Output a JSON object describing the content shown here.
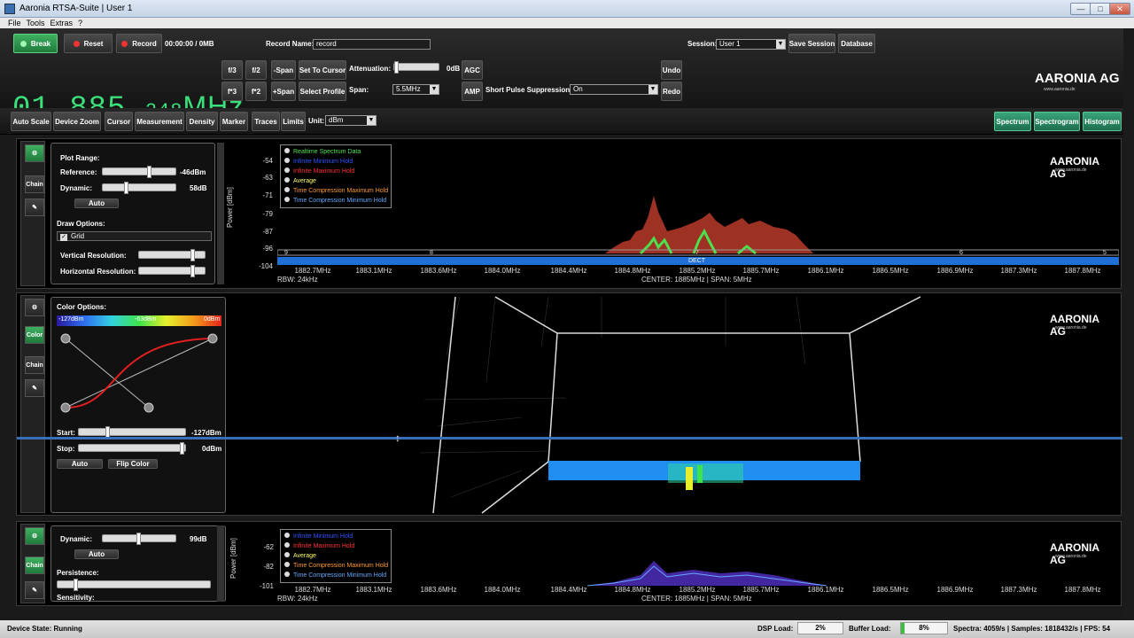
{
  "window": {
    "title": "Aaronia RTSA-Suite | User 1",
    "min": "—",
    "max": "□",
    "close": "✕"
  },
  "menu": [
    "File",
    "Tools",
    "Extras",
    "?"
  ],
  "toolbar": {
    "break_label": "Break",
    "reset_label": "Reset",
    "record_label": "Record",
    "record_time": "00:00:00 / 0MB",
    "record_name_label": "Record Name:",
    "record_name_value": "record",
    "session_label": "Session:",
    "session_value": "User 1",
    "save_session": "Save Session",
    "database": "Database",
    "frequency_main": "01.885.",
    "frequency_small": "248",
    "frequency_unit": "MHz",
    "f3": "f/3",
    "f2": "f/2",
    "minus_span": "-Span",
    "set_to_cursor": "Set To Cursor",
    "f3x": "f*3",
    "f2x": "f*2",
    "plus_span": "+Span",
    "select_profile": "Select Profile",
    "attenuation_label": "Attenuation:",
    "attenuation_value": "0dB",
    "span_label": "Span:",
    "span_value": "5.5MHz",
    "agc": "AGC",
    "amp": "AMP",
    "short_pulse_label": "Short Pulse Suppression:",
    "short_pulse_value": "On",
    "undo": "Undo",
    "redo": "Redo",
    "logo": "AARONIA AG",
    "logo_sub": "www.aaronia.de"
  },
  "toolbar2": {
    "buttons": [
      "Auto Scale",
      "Device Zoom",
      "Cursor",
      "Measurement",
      "Density",
      "Marker",
      "Traces",
      "Limits"
    ],
    "unit_label": "Unit:",
    "unit_value": "dBm",
    "views": [
      "Spectrum",
      "Spectrogram",
      "Histogram"
    ]
  },
  "colors": {
    "accent_green": "#3ce07a",
    "band_blue": "#1f6fd6",
    "trace_red": "#c0392b"
  },
  "spectrum": {
    "side": {
      "chain": "Chain"
    },
    "options": {
      "plot_range": "Plot Range:",
      "reference_label": "Reference:",
      "reference_value": "-46dBm",
      "dynamic_label": "Dynamic:",
      "dynamic_value": "58dB",
      "auto": "Auto",
      "draw_options": "Draw Options:",
      "grid": "Grid",
      "vres_label": "Vertical Resolution:",
      "hres_label": "Horizontal Resolution:"
    },
    "yaxis_label": "Power [dBm]",
    "yticks": [
      "-54",
      "-63",
      "-71",
      "-79",
      "-87",
      "-96",
      "-104"
    ],
    "xticks": [
      "1882.7MHz",
      "1883.1MHz",
      "1883.6MHz",
      "1884.0MHz",
      "1884.4MHz",
      "1884.8MHz",
      "1885.2MHz",
      "1885.7MHz",
      "1886.1MHz",
      "1886.5MHz",
      "1886.9MHz",
      "1887.3MHz",
      "1887.8MHz"
    ],
    "rbw": "RBW: 24kHz",
    "center": "CENTER: 1885MHz | SPAN: 5MHz",
    "channels": [
      "9",
      "8",
      "7",
      "6",
      "5"
    ],
    "band_label": "DECT",
    "legend": [
      {
        "label": "Realtime Spectrum Data",
        "color": "#4de04d"
      },
      {
        "label": "Infinite Minimum Hold",
        "color": "#3355ff"
      },
      {
        "label": "Infinite Maximum Hold",
        "color": "#ff3333"
      },
      {
        "label": "Average",
        "color": "#ffff66"
      },
      {
        "label": "Time Compression Maximum Hold",
        "color": "#ff9933"
      },
      {
        "label": "Time Compression Minimum Hold",
        "color": "#66aaff"
      }
    ]
  },
  "waterfall": {
    "side": {
      "color": "Color",
      "chain": "Chain"
    },
    "options": {
      "color_options": "Color Options:",
      "grad_min": "-127dBm",
      "grad_mid": "-63dBm",
      "grad_max": "0dBm",
      "start_label": "Start:",
      "start_value": "-127dBm",
      "stop_label": "Stop:",
      "stop_value": "0dBm",
      "auto": "Auto",
      "flip": "Flip Color"
    }
  },
  "histogram": {
    "side": {
      "chain": "Chain"
    },
    "options": {
      "dynamic_label": "Dynamic:",
      "dynamic_value": "99dB",
      "auto": "Auto",
      "persistence": "Persistence:",
      "sensitivity": "Sensitivity:"
    },
    "yaxis_label": "Power [dBm]",
    "yticks": [
      "-62",
      "-82",
      "-101"
    ],
    "rbw": "RBW: 24kHz",
    "center": "CENTER: 1885MHz | SPAN: 5MHz",
    "legend": [
      {
        "label": "Infinite Minimum Hold",
        "color": "#3355ff"
      },
      {
        "label": "Infinite Maximum Hold",
        "color": "#ff3333"
      },
      {
        "label": "Average",
        "color": "#ffff66"
      },
      {
        "label": "Time Compression Maximum Hold",
        "color": "#ff9933"
      },
      {
        "label": "Time Compression Minimum Hold",
        "color": "#66aaff"
      }
    ]
  },
  "status": {
    "device_state": "Device State: Running",
    "dsp_label": "DSP Load:",
    "dsp_value": "2%",
    "buffer_label": "Buffer Load:",
    "buffer_value": "8%",
    "buffer_fill": 0.08,
    "spectra": "Spectra: 4059/s | Samples: 1818432/s | FPS: 54"
  }
}
